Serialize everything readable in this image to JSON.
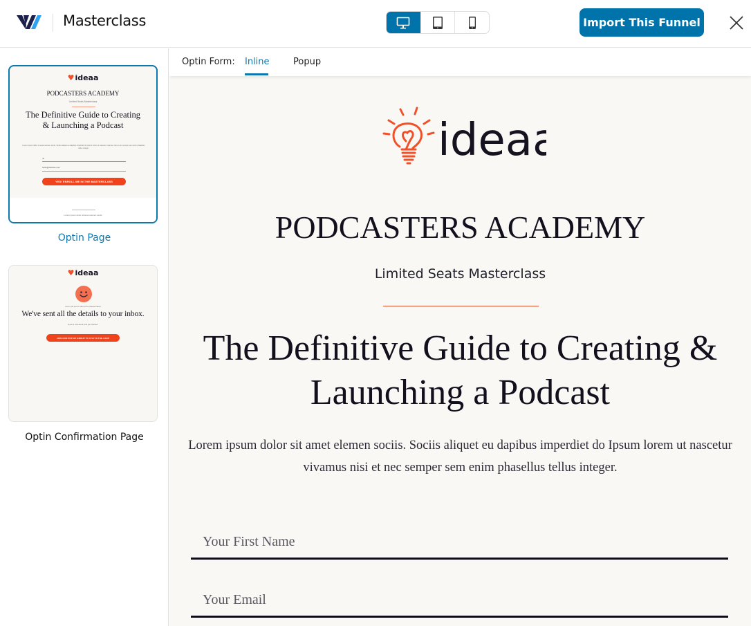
{
  "header": {
    "app_title": "Masterclass",
    "logo_icon": "brand-logo-icon",
    "device_modes": [
      {
        "name": "desktop",
        "icon": "desktop-icon",
        "active": true
      },
      {
        "name": "tablet",
        "icon": "tablet-icon",
        "active": false
      },
      {
        "name": "mobile",
        "icon": "mobile-icon",
        "active": false
      }
    ],
    "import_label": "Import This Funnel",
    "close_icon": "close-icon",
    "accent_color": "#0073aa"
  },
  "sidebar": {
    "pages": [
      {
        "label": "Optin Page",
        "selected": true,
        "thumbnail": {
          "brand": "ideaa",
          "academy": "PODCASTERS ACADEMY",
          "tagline": "Limited Seats Masterclass",
          "headline": "The Definitive Guide to Creating & Launching a Podcast",
          "body": "Lorem ipsum dolor sit amet elemen sociis. Sociis aliquet eu dapibus imperdiet do Ipsum lorem ut nascetur vivamus nisi et nec semper sem enim phasellus tellus integer.",
          "field1": "Jo",
          "field2": "hello@website.com",
          "button": "YES! ENROLL ME IN THE MASTERCLASS",
          "footer_text": "Lorem ipsum dolor sit amet elemen sociis"
        }
      },
      {
        "label": "Optin Confirmation Page",
        "selected": false,
        "thumbnail": {
          "brand": "ideaa",
          "kicker": "You're all set to attend the Masterclass!",
          "headline": "We've sent all the details to your inbox.",
          "sub": "Grab a notebook and get started.",
          "button": "JOIN OUR POP-UP GROUP TO STAY IN THE LOOP"
        }
      }
    ]
  },
  "subbar": {
    "label": "Optin Form:",
    "tabs": [
      {
        "label": "Inline",
        "active": true
      },
      {
        "label": "Popup",
        "active": false
      }
    ]
  },
  "preview": {
    "brand": "ideaa",
    "brand_color": "#f0512a",
    "academy": "PODCASTERS ACADEMY",
    "tagline": "Limited Seats Masterclass",
    "headline": "The Definitive Guide to Creating & Launching a Podcast",
    "description": "Lorem ipsum dolor sit amet elemen sociis. Sociis aliquet eu dapibus imperdiet do Ipsum lorem ut nascetur vivamus nisi et nec semper sem enim phasellus tellus integer.",
    "first_name_placeholder": "Your First Name",
    "email_placeholder": "Your Email"
  }
}
